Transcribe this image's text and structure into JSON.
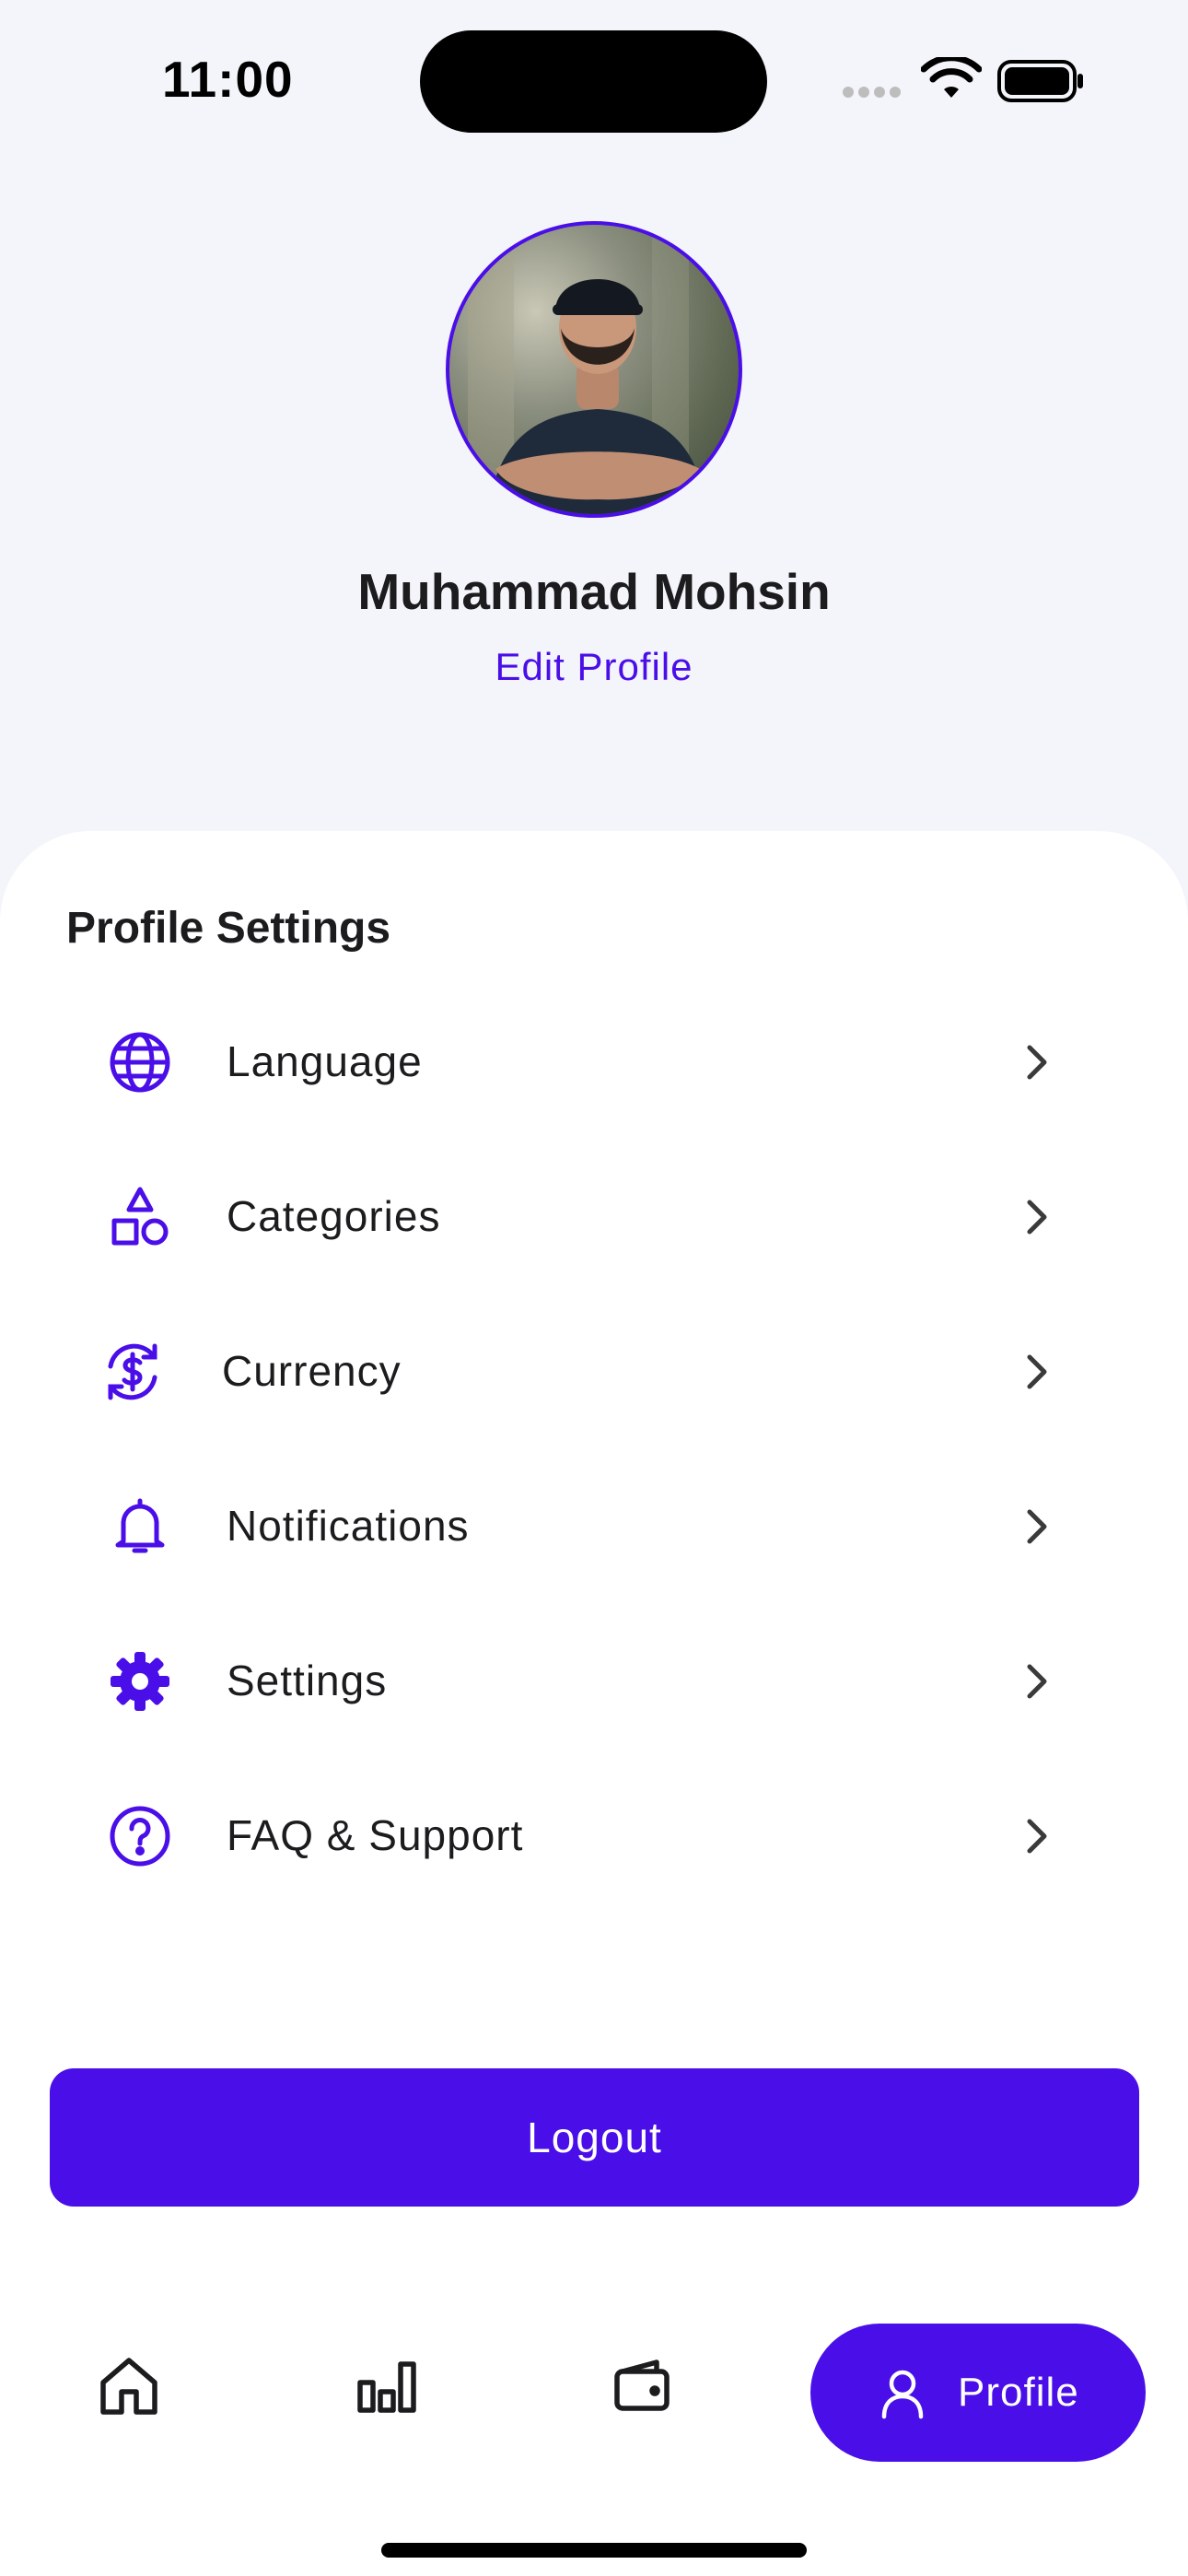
{
  "status_bar": {
    "time": "11:00"
  },
  "profile": {
    "name": "Muhammad Mohsin",
    "edit_label": "Edit Profile"
  },
  "settings": {
    "title": "Profile Settings",
    "items": [
      {
        "label": "Language",
        "icon": "globe-icon"
      },
      {
        "label": "Categories",
        "icon": "shapes-icon"
      },
      {
        "label": "Currency",
        "icon": "currency-exchange-icon"
      },
      {
        "label": "Notifications",
        "icon": "bell-icon"
      },
      {
        "label": "Settings",
        "icon": "gear-icon"
      },
      {
        "label": "FAQ & Support",
        "icon": "question-circle-icon"
      }
    ]
  },
  "logout_label": "Logout",
  "bottom_nav": {
    "items": [
      {
        "icon": "home-icon"
      },
      {
        "icon": "bar-chart-icon"
      },
      {
        "icon": "wallet-icon"
      },
      {
        "icon": "user-icon",
        "label": "Profile",
        "active": true
      }
    ]
  },
  "colors": {
    "accent": "#4A0EE8",
    "background": "#F3F5FA",
    "card": "#FFFFFF",
    "text": "#1C1C1E"
  }
}
